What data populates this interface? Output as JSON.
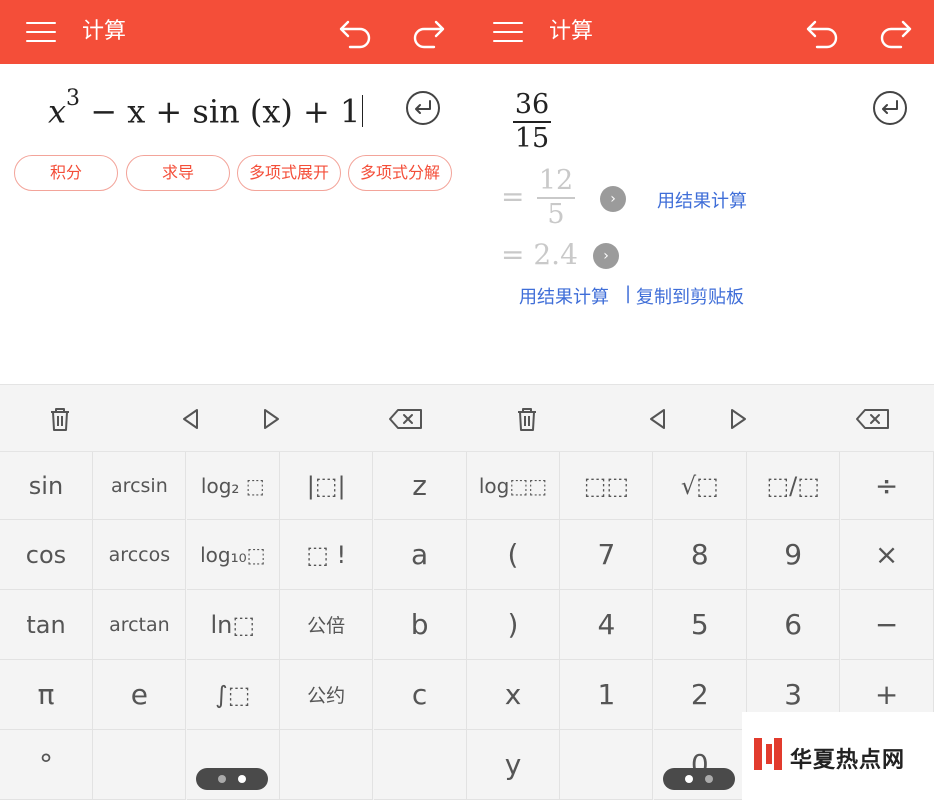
{
  "left": {
    "title": "计算",
    "expression": {
      "base": "x",
      "exponent": "3",
      "rest": "− x + sin (x) + 1"
    },
    "chips": [
      "积分",
      "求导",
      "多项式展开",
      "多项式分解"
    ]
  },
  "right": {
    "title": "计算",
    "result": {
      "numerator": "36",
      "denominator": "15"
    },
    "simplified": {
      "equals": "=",
      "numerator": "12",
      "denominator": "5"
    },
    "decimal": "= 2.4",
    "use_result_link_1": "用结果计算",
    "use_result_link_2": "用结果计算",
    "separator": "|",
    "copy_link": "复制到剪贴板"
  },
  "left_keys": [
    [
      "sin",
      "arcsin",
      "log₂ ⬚",
      "|⬚|",
      "z"
    ],
    [
      "cos",
      "arccos",
      "log₁₀⬚",
      "⬚ !",
      "a"
    ],
    [
      "tan",
      "arctan",
      "ln⬚",
      "公倍",
      "b"
    ],
    [
      "π",
      "e",
      "∫⬚",
      "公约",
      "c"
    ],
    [
      "°",
      "",
      "",
      "",
      ""
    ]
  ],
  "right_keys": [
    [
      "log⬚⬚",
      "⬚⬚",
      "√⬚",
      "⬚/⬚",
      "÷"
    ],
    [
      "(",
      "7",
      "8",
      "9",
      "×"
    ],
    [
      ")",
      "4",
      "5",
      "6",
      "−"
    ],
    [
      "x",
      "1",
      "2",
      "3",
      "+"
    ],
    [
      "y",
      "",
      "0",
      "",
      ""
    ]
  ],
  "icons": {
    "menu": "menu-icon",
    "undo": "undo-icon",
    "redo": "redo-icon",
    "enter": "enter-icon",
    "trash": "trash-icon",
    "left": "left-arrow-icon",
    "right": "right-arrow-icon",
    "backspace": "backspace-icon"
  },
  "colors": {
    "accent": "#f44e39",
    "link": "#3f6ed8",
    "keypad_bg": "#f4f4f4",
    "key_text": "#555555"
  },
  "watermark": {
    "text": "华夏热点网"
  }
}
